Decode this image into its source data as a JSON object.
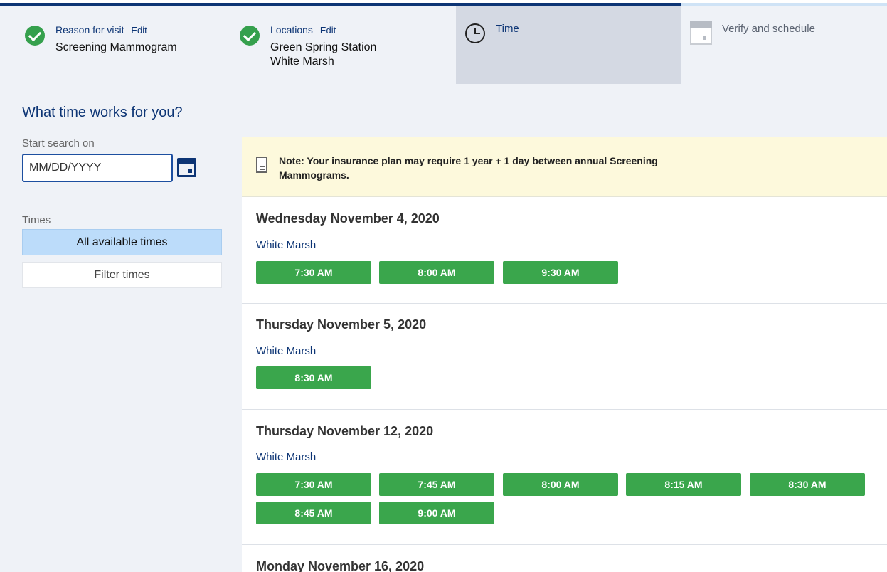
{
  "stepper": {
    "steps": [
      {
        "title": "Reason for visit",
        "edit": "Edit",
        "value": "Screening Mammogram",
        "state": "complete"
      },
      {
        "title": "Locations",
        "edit": "Edit",
        "value_lines": [
          "Green Spring Station",
          "White Marsh"
        ],
        "state": "complete"
      },
      {
        "title": "Time",
        "state": "current",
        "icon": "clock-icon"
      },
      {
        "title": "Verify and schedule",
        "state": "upcoming",
        "icon": "calendar-icon"
      }
    ]
  },
  "sidebar": {
    "heading": "What time works for you?",
    "start_label": "Start search on",
    "date_placeholder": "MM/DD/YYYY",
    "times_label": "Times",
    "times_options": [
      "All available times",
      "Filter times"
    ],
    "selected_option": "All available times"
  },
  "note": {
    "text": "Note: Your insurance plan may require 1 year + 1 day between annual Screening Mammograms."
  },
  "days": [
    {
      "date": "Wednesday November 4, 2020",
      "location": "White Marsh",
      "slots": [
        "7:30 AM",
        "8:00 AM",
        "9:30 AM"
      ]
    },
    {
      "date": "Thursday November 5, 2020",
      "location": "White Marsh",
      "slots": [
        "8:30 AM"
      ]
    },
    {
      "date": "Thursday November 12, 2020",
      "location": "White Marsh",
      "slots": [
        "7:30 AM",
        "7:45 AM",
        "8:00 AM",
        "8:15 AM",
        "8:30 AM",
        "8:45 AM",
        "9:00 AM"
      ]
    },
    {
      "date": "Monday November 16, 2020"
    }
  ],
  "colors": {
    "brand_navy": "#0d3575",
    "slot_green": "#3aa64c",
    "selected_blue": "#bcdcfa",
    "note_yellow": "#fdf9dc"
  }
}
